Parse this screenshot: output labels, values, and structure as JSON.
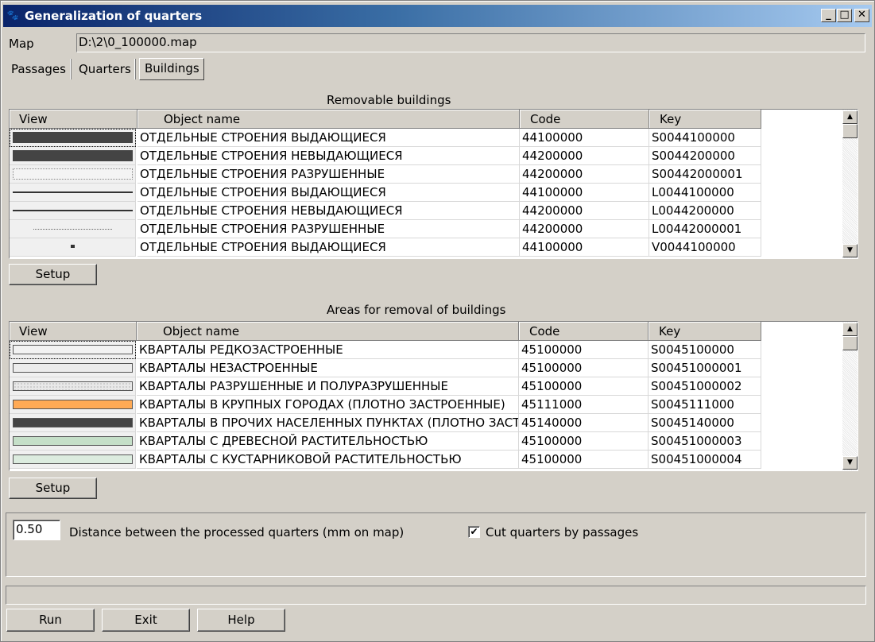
{
  "window": {
    "title": "Generalization of quarters",
    "minimize": "_",
    "maximize": "□",
    "close": "✕",
    "icon": "app-icon"
  },
  "map": {
    "label": "Map",
    "value": "D:\\2\\0_100000.map"
  },
  "tabs": [
    {
      "label": "Passages"
    },
    {
      "label": "Quarters"
    },
    {
      "label": "Buildings",
      "active": true
    }
  ],
  "removable": {
    "caption": "Removable buildings",
    "headers": {
      "view": "View",
      "name": "Object name",
      "code": "Code",
      "key": "Key"
    },
    "rows": [
      {
        "view": "solid-dark",
        "name": "ОТДЕЛЬНЫЕ СТРОЕНИЯ ВЫДАЮЩИЕСЯ",
        "code": "44100000",
        "key": "S0044100000"
      },
      {
        "view": "solid-dark",
        "name": "ОТДЕЛЬНЫЕ СТРОЕНИЯ НЕВЫДАЮЩИЕСЯ",
        "code": "44200000",
        "key": "S0044200000"
      },
      {
        "view": "dotted-box",
        "name": "ОТДЕЛЬНЫЕ СТРОЕНИЯ РАЗРУШЕННЫЕ",
        "code": "44200000",
        "key": "S00442000001"
      },
      {
        "view": "line",
        "name": "ОТДЕЛЬНЫЕ СТРОЕНИЯ ВЫДАЮЩИЕСЯ",
        "code": "44100000",
        "key": "L0044100000"
      },
      {
        "view": "line",
        "name": "ОТДЕЛЬНЫЕ СТРОЕНИЯ НЕВЫДАЮЩИЕСЯ",
        "code": "44200000",
        "key": "L0044200000"
      },
      {
        "view": "dotted-line",
        "name": "ОТДЕЛЬНЫЕ СТРОЕНИЯ РАЗРУШЕННЫЕ",
        "code": "44200000",
        "key": "L00442000001"
      },
      {
        "view": "dot",
        "name": "ОТДЕЛЬНЫЕ СТРОЕНИЯ ВЫДАЮЩИЕСЯ",
        "code": "44100000",
        "key": "V0044100000"
      }
    ],
    "setup_label": "Setup"
  },
  "areas": {
    "caption": "Areas for removal of buildings",
    "headers": {
      "view": "View",
      "name": "Object name",
      "code": "Code",
      "key": "Key"
    },
    "rows": [
      {
        "view": "fill",
        "color": "#f2f2f2",
        "name": "КВАРТАЛЫ РЕДКОЗАСТРОЕННЫЕ",
        "code": "45100000",
        "key": "S0045100000"
      },
      {
        "view": "fill",
        "color": "#ececec",
        "name": "КВАРТАЛЫ НЕЗАСТРОЕННЫЕ",
        "code": "45100000",
        "key": "S00451000001"
      },
      {
        "view": "dotted-fill",
        "color": "#e8e8e8",
        "name": "КВАРТАЛЫ РАЗРУШЕННЫЕ И ПОЛУРАЗРУШЕННЫЕ",
        "code": "45100000",
        "key": "S00451000002"
      },
      {
        "view": "fill",
        "color": "#ffaa55",
        "name": "КВАРТАЛЫ В КРУПНЫХ ГОРОДАХ (ПЛОТНО ЗАСТРОЕННЫЕ)",
        "code": "45111000",
        "key": "S0045111000"
      },
      {
        "view": "fill",
        "color": "#444444",
        "name": "КВАРТАЛЫ В ПРОЧИХ НАСЕЛЕННЫХ ПУНКТАХ (ПЛОТНО ЗАСТРО",
        "code": "45140000",
        "key": "S0045140000"
      },
      {
        "view": "fill",
        "color": "#c5dfc8",
        "name": "КВАРТАЛЫ С ДРЕВЕСНОЙ РАСТИТЕЛЬНОСТЬЮ",
        "code": "45100000",
        "key": "S00451000003"
      },
      {
        "view": "fill",
        "color": "#dcecdf",
        "name": "КВАРТАЛЫ С КУСТАРНИКОВОЙ РАСТИТЕЛЬНОСТЬЮ",
        "code": "45100000",
        "key": "S00451000004"
      }
    ],
    "setup_label": "Setup"
  },
  "options": {
    "distance_value": "0.50",
    "distance_label": "Distance between the processed quarters (mm on map)",
    "cut_checked": true,
    "cut_label": "Cut quarters by passages"
  },
  "buttons": {
    "run": "Run",
    "exit": "Exit",
    "help": "Help"
  }
}
